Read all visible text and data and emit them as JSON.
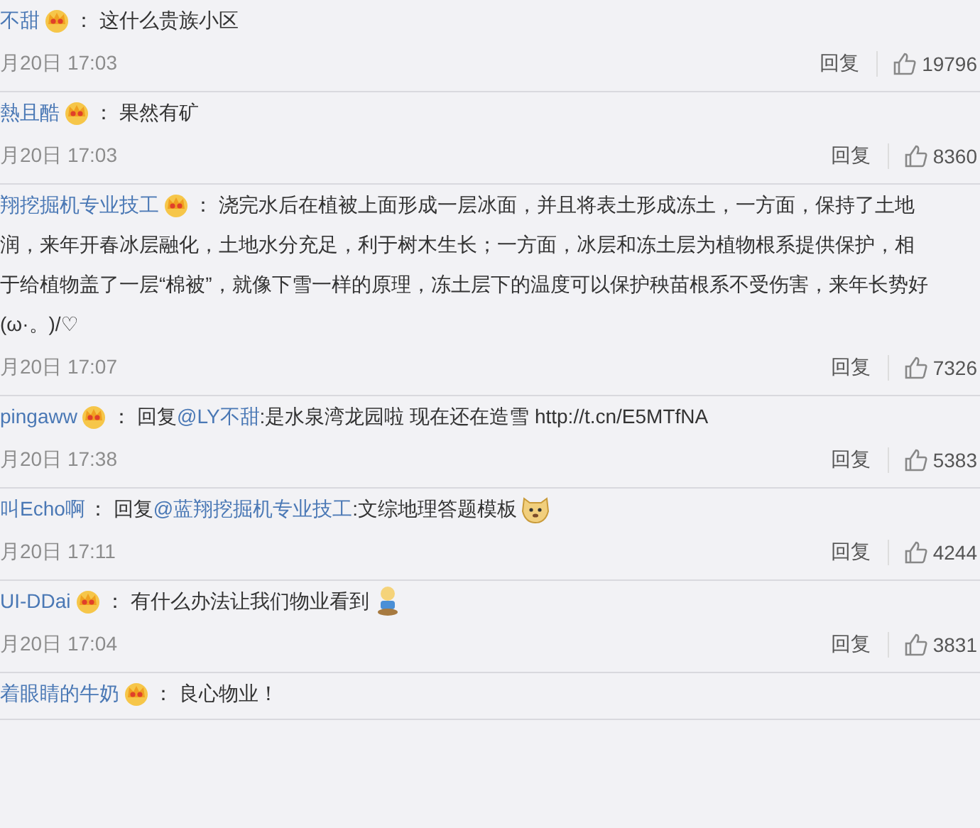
{
  "comments": [
    {
      "name": "不甜",
      "vip": true,
      "separator": "：",
      "lines": [
        [
          {
            "kind": "text",
            "text": "这什么贵族小区"
          }
        ]
      ],
      "time": "月20日 17:03",
      "reply": "回复",
      "likes": "19796"
    },
    {
      "name": "熱且酷",
      "vip": true,
      "separator": "：",
      "lines": [
        [
          {
            "kind": "text",
            "text": "果然有矿"
          }
        ]
      ],
      "time": "月20日 17:03",
      "reply": "回复",
      "likes": "8360"
    },
    {
      "name": "翔挖掘机专业技工",
      "vip": true,
      "separator": "：",
      "lines": [
        [
          {
            "kind": "text",
            "text": "浇完水后在植被上面形成一层冰面，并且将表土形成冻土，一方面，保持了土地"
          }
        ],
        [
          {
            "kind": "text",
            "text": "润，来年开春冰层融化，土地水分充足，利于树木生长；一方面，冰层和冻土层为植物根系提供保护，相"
          }
        ],
        [
          {
            "kind": "text",
            "text": "于给植物盖了一层“棉被”，就像下雪一样的原理，冻土层下的温度可以保护秧苗根系不受伤害，来年长势好"
          }
        ],
        [
          {
            "kind": "text",
            "text": "(ω·。)/♡"
          }
        ]
      ],
      "time": "月20日 17:07",
      "reply": "回复",
      "likes": "7326"
    },
    {
      "name": "pingaww",
      "vip": true,
      "separator": "：",
      "lines": [
        [
          {
            "kind": "text",
            "text": "回复"
          },
          {
            "kind": "mention",
            "text": "@LY不甜"
          },
          {
            "kind": "text",
            "text": ":是水泉湾龙园啦 现在还在造雪 http://t.cn/E5MTfNA"
          }
        ]
      ],
      "time": "月20日 17:38",
      "reply": "回复",
      "likes": "5383"
    },
    {
      "name": "叫Echo啊",
      "vip": false,
      "separator": "：",
      "lines": [
        [
          {
            "kind": "text",
            "text": "回复"
          },
          {
            "kind": "mention",
            "text": "@蓝翔挖掘机专业技工"
          },
          {
            "kind": "text",
            "text": ":文综地理答题模板"
          },
          {
            "kind": "doge"
          }
        ]
      ],
      "time": "月20日 17:11",
      "reply": "回复",
      "likes": "4244"
    },
    {
      "name": "UI-DDai",
      "vip": true,
      "separator": "：",
      "lines": [
        [
          {
            "kind": "text",
            "text": "有什么办法让我们物业看到"
          },
          {
            "kind": "figure"
          }
        ]
      ],
      "time": "月20日 17:04",
      "reply": "回复",
      "likes": "3831"
    },
    {
      "name": "着眼睛的牛奶",
      "vip": true,
      "separator": "：",
      "lines": [
        [
          {
            "kind": "text",
            "text": "良心物业！"
          }
        ]
      ]
    }
  ]
}
